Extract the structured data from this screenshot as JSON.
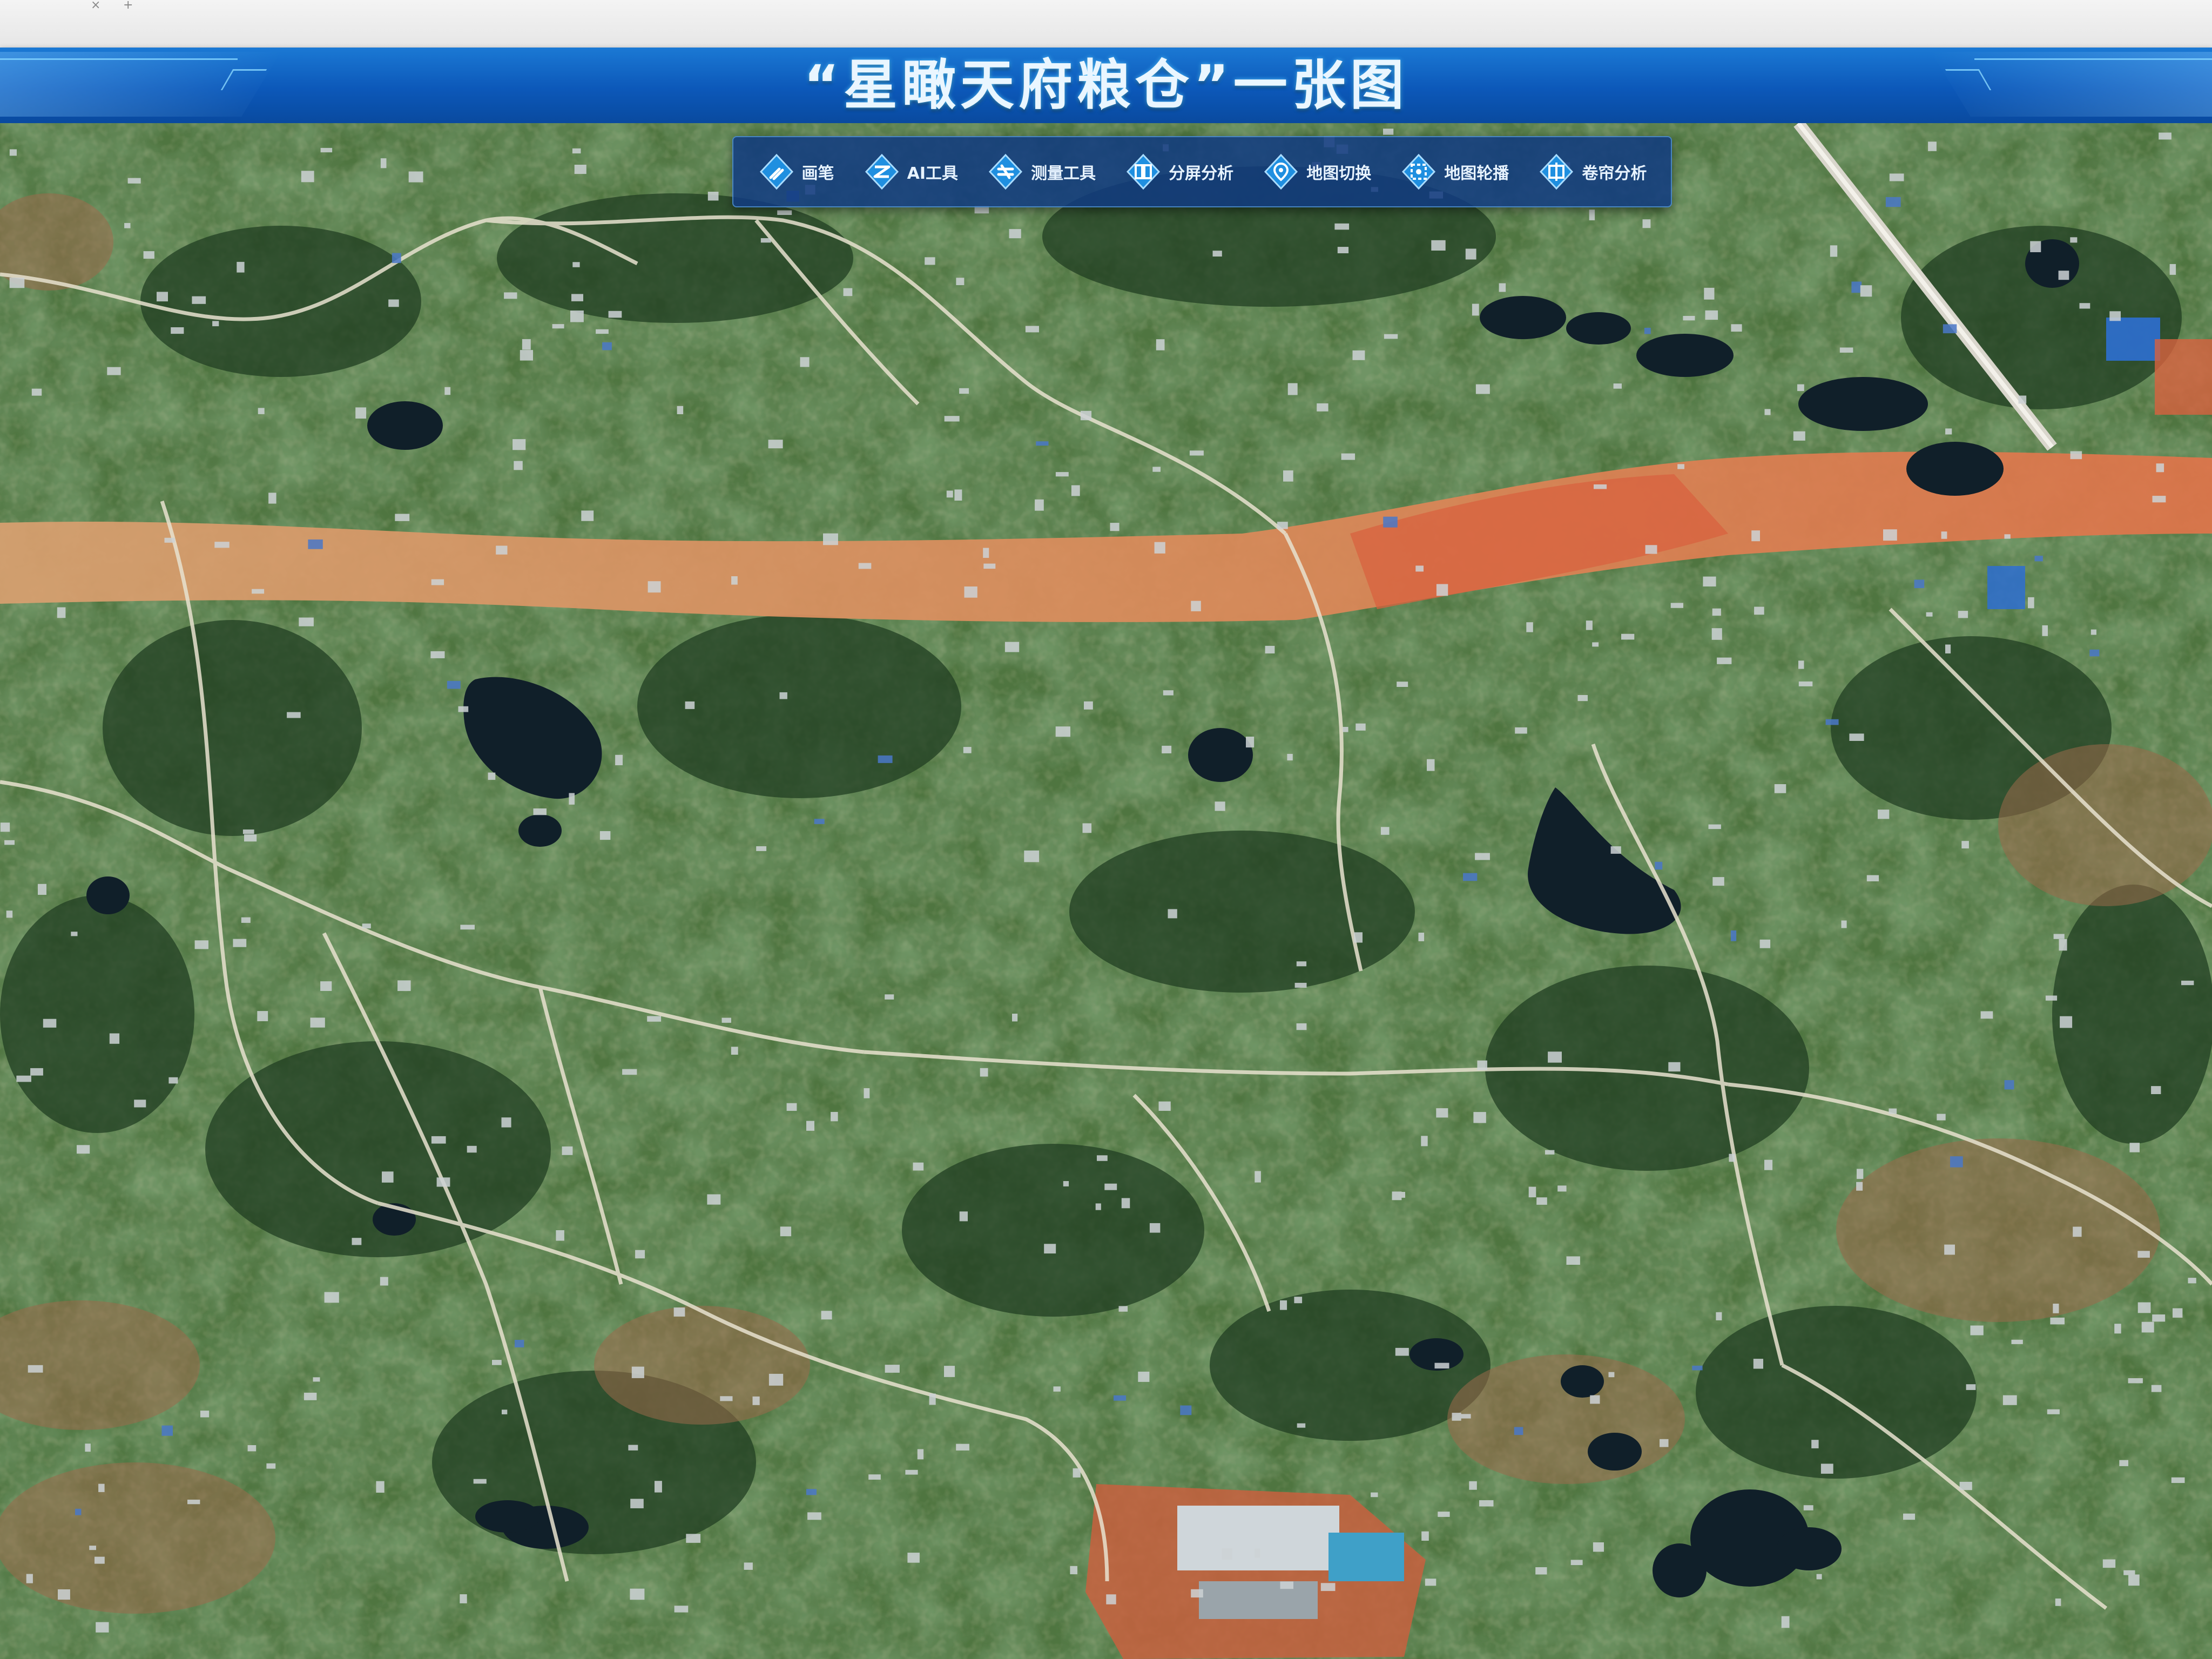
{
  "header": {
    "title": "“星瞰天府粮仓”一张图"
  },
  "toolbar": {
    "items": [
      {
        "label": "画笔",
        "icon": "brush-icon"
      },
      {
        "label": "AI工具",
        "icon": "ai-tool-icon"
      },
      {
        "label": "测量工具",
        "icon": "measure-icon"
      },
      {
        "label": "分屏分析",
        "icon": "split-screen-icon"
      },
      {
        "label": "地图切换",
        "icon": "map-switch-icon"
      },
      {
        "label": "地图轮播",
        "icon": "map-carousel-icon"
      },
      {
        "label": "卷帘分析",
        "icon": "swipe-analysis-icon"
      }
    ]
  },
  "map": {
    "type": "satellite-imagery",
    "colors": {
      "vegetation": "#3c6b34",
      "dark_forest": "#1f3f22",
      "farmland": "#7a7a4a",
      "bare_soil": "#d98a5a",
      "construction_red": "#d8623f",
      "water": "#10202b",
      "building": "#c9ced2",
      "road": "#e8e2cf"
    }
  }
}
